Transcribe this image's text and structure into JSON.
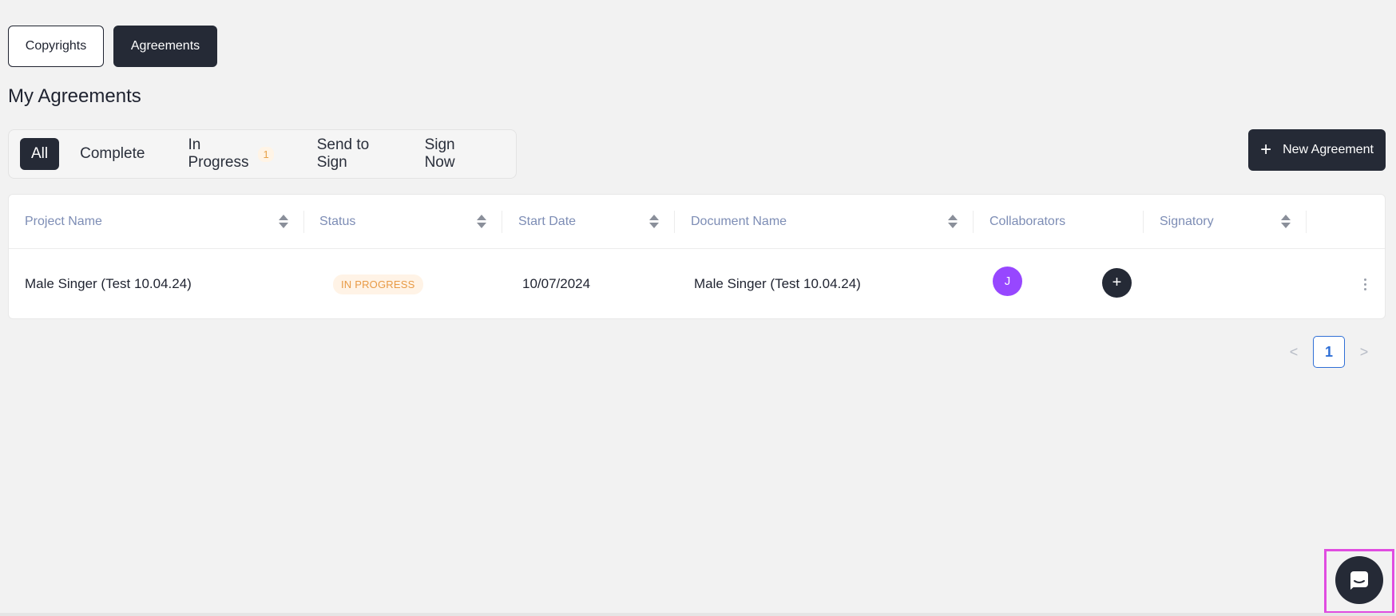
{
  "top_toggle": {
    "copyrights_label": "Copyrights",
    "agreements_label": "Agreements"
  },
  "page_title": "My Agreements",
  "filters": {
    "all": "All",
    "complete": "Complete",
    "in_progress": "In Progress",
    "in_progress_count": "1",
    "send_to_sign": "Send to Sign",
    "sign_now": "Sign Now"
  },
  "new_agreement_label": "New Agreement",
  "table": {
    "headers": {
      "project_name": "Project Name",
      "status": "Status",
      "start_date": "Start Date",
      "document_name": "Document Name",
      "collaborators": "Collaborators",
      "signatory": "Signatory"
    },
    "rows": [
      {
        "project_name": "Male Singer (Test 10.04.24)",
        "status": "IN PROGRESS",
        "start_date": "10/07/2024",
        "document_name": "Male Singer (Test 10.04.24)",
        "collaborator_initial": "J",
        "add_collaborator_symbol": "+",
        "signatory": ""
      }
    ]
  },
  "pagination": {
    "current_page": "1",
    "prev_symbol": "<",
    "next_symbol": ">"
  },
  "colors": {
    "primary_dark": "#252a36",
    "avatar_purple": "#9747ff",
    "status_orange": "#e89a45",
    "page_link_blue": "#2f6fd6"
  },
  "icons": {
    "sort": "sort-icon",
    "plus": "plus-icon",
    "chat": "chat-icon",
    "more": "more-vertical-icon"
  }
}
